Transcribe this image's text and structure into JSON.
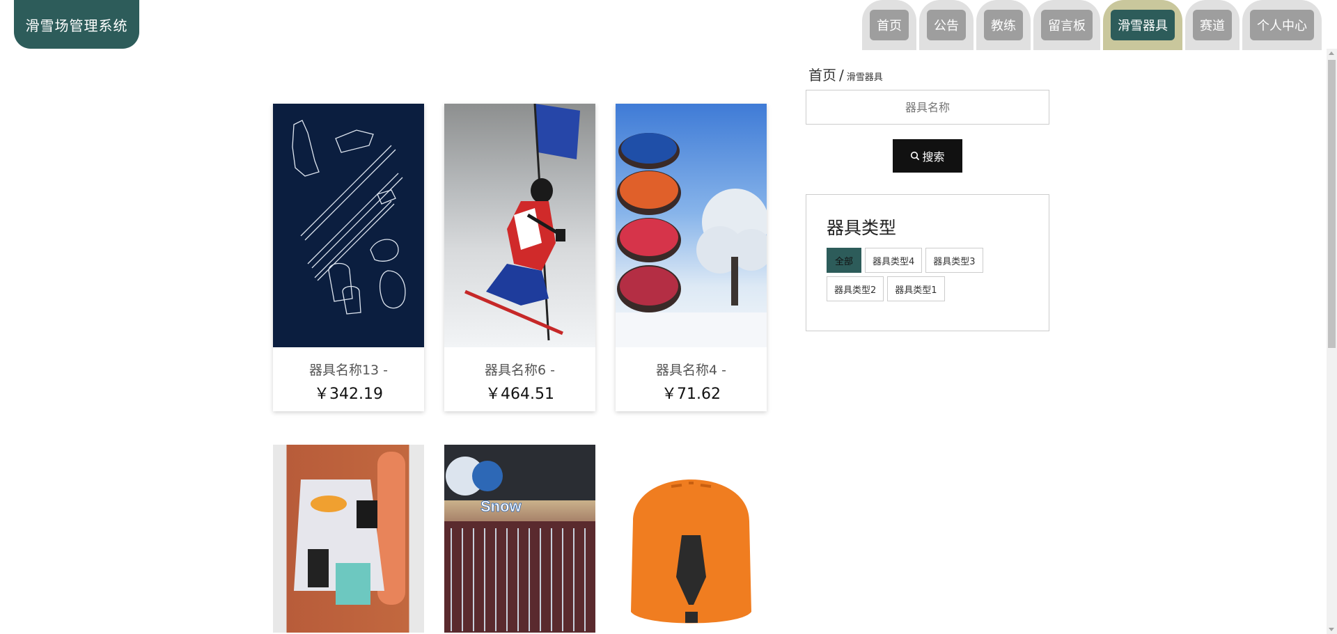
{
  "app": {
    "title": "滑雪场管理系统"
  },
  "nav": {
    "items": [
      {
        "label": "首页"
      },
      {
        "label": "公告"
      },
      {
        "label": "教练"
      },
      {
        "label": "留言板"
      },
      {
        "label": "滑雪器具",
        "active": true
      },
      {
        "label": "赛道"
      },
      {
        "label": "个人中心"
      }
    ]
  },
  "breadcrumb": {
    "home": "首页",
    "sep": "/",
    "current": "滑雪器具"
  },
  "search": {
    "placeholder": "器具名称",
    "button_label": "搜索",
    "icon": "search-icon"
  },
  "types": {
    "title": "器具类型",
    "tags": [
      {
        "label": "全部",
        "active": true
      },
      {
        "label": "器具类型4"
      },
      {
        "label": "器具类型3"
      },
      {
        "label": "器具类型2"
      },
      {
        "label": "器具类型1"
      }
    ]
  },
  "products": [
    {
      "name": "器具名称13 -",
      "price": "￥342.19",
      "image": "ski-equipment-sketch"
    },
    {
      "name": "器具名称6 -",
      "price": "￥464.51",
      "image": "skier-racing"
    },
    {
      "name": "器具名称4 -",
      "price": "￥71.62",
      "image": "snow-tubes-tree"
    },
    {
      "image": "ski-jacket-snowboard"
    },
    {
      "image": "ski-rental-shop"
    },
    {
      "image": "orange-ski-helmet"
    }
  ],
  "image_texts": {
    "snow_logo": "Snow"
  }
}
